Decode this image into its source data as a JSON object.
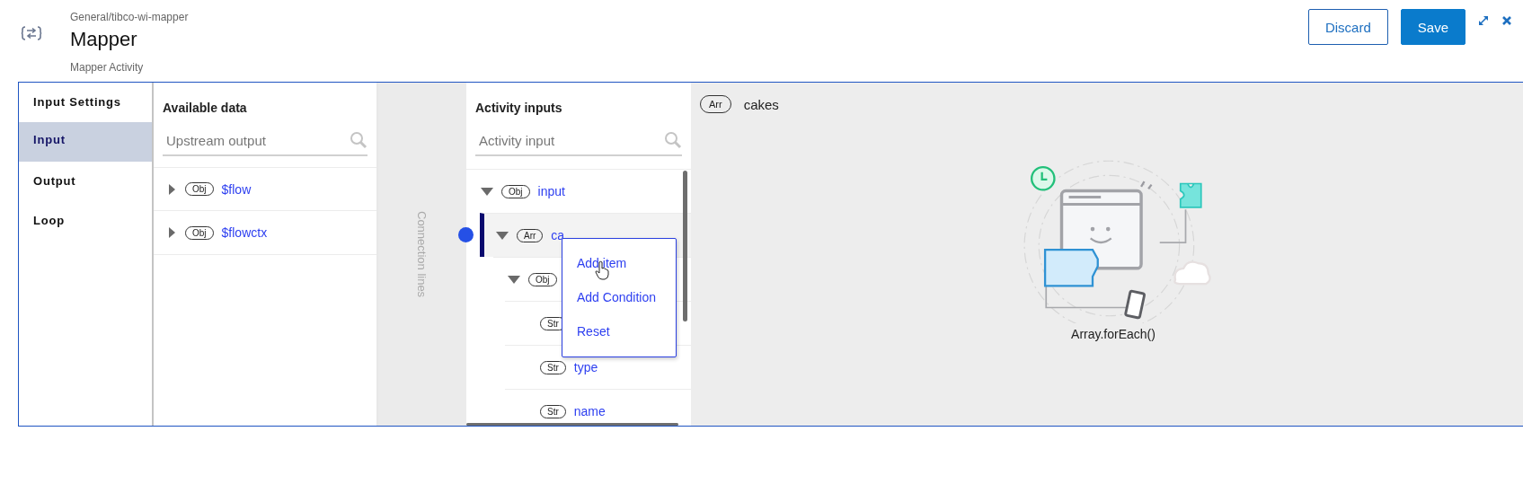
{
  "header": {
    "breadcrumb": "General/tibco-wi-mapper",
    "title": "Mapper",
    "subtitle": "Mapper Activity",
    "buttons": [
      {
        "label": "Discard",
        "kind": "secondary"
      },
      {
        "label": "Save",
        "kind": "primary"
      }
    ]
  },
  "tabs": [
    {
      "label": "Input Settings",
      "selected": false
    },
    {
      "label": "Input",
      "selected": true
    },
    {
      "label": "Output",
      "selected": false
    },
    {
      "label": "Loop",
      "selected": false
    }
  ],
  "available_data": {
    "title": "Available data",
    "search": {
      "placeholder": "Upstream output"
    },
    "items": [
      {
        "type": "Obj",
        "label": "$flow",
        "expanded": false
      },
      {
        "type": "Obj",
        "label": "$flowctx",
        "expanded": false
      }
    ]
  },
  "connection_lines": {
    "label": "Connection lines"
  },
  "activity_inputs": {
    "title": "Activity inputs",
    "search": {
      "placeholder": "Activity input"
    },
    "tree": [
      {
        "type": "Obj",
        "label": "input",
        "expanded": true,
        "selected": false,
        "children": [
          {
            "type": "Arr",
            "label": "ca",
            "expanded": true,
            "selected": true,
            "children": [
              {
                "type": "Obj",
                "expanded": true,
                "selected": false,
                "children": [
                  {
                    "type": "Str",
                    "selected": false
                  },
                  {
                    "type": "Str",
                    "label": "type",
                    "selected": false
                  },
                  {
                    "type": "Str",
                    "label": "name",
                    "selected": false
                  }
                ]
              }
            ]
          }
        ]
      }
    ]
  },
  "context_menu": {
    "items": [
      "Add item",
      "Add Condition",
      "Reset"
    ]
  },
  "detail": {
    "type": "Arr",
    "label": "cakes",
    "caption": "Array.forEach()"
  }
}
